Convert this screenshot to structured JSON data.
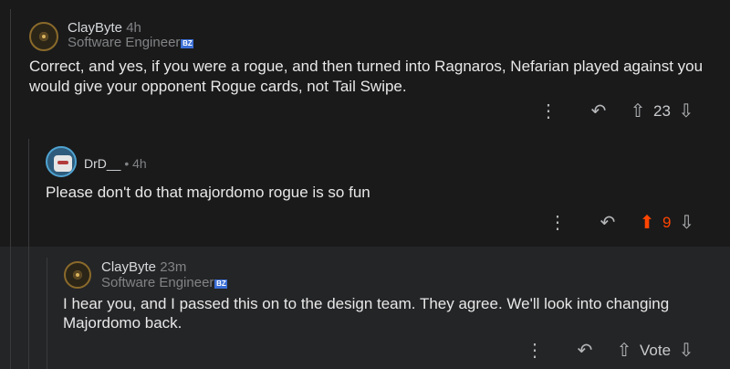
{
  "comments": [
    {
      "username": "ClayByte",
      "time": "4h",
      "flair": "Software Engineer",
      "body": "Correct, and yes, if you were a rogue, and then turned into Ragnaros, Nefarian played against you would give your opponent Rogue cards, not Tail Swipe.",
      "score": "23",
      "upvoted": false
    },
    {
      "username": "DrD__",
      "time": "• 4h",
      "body": "Please don't do that majordomo rogue is so fun",
      "score": "9",
      "upvoted": true
    },
    {
      "username": "ClayByte",
      "time": "23m",
      "flair": "Software Engineer",
      "body_line1": "I hear you, and I passed this on to the design team. They agree. We'll look into changing",
      "body_line2": "Majordomo back.",
      "score": "Vote",
      "upvoted": false
    }
  ],
  "icons": {
    "more": "more-icon",
    "reply": "reply-icon",
    "upvote": "upvote-icon",
    "downvote": "downvote-icon",
    "flair_badge": "blizzard-badge"
  },
  "flair_badge_text": "BZ",
  "colors": {
    "background": "#1a1a1b",
    "reply_background": "#242527",
    "upvote_active": "#ff4500",
    "text": "#d7dadc"
  }
}
